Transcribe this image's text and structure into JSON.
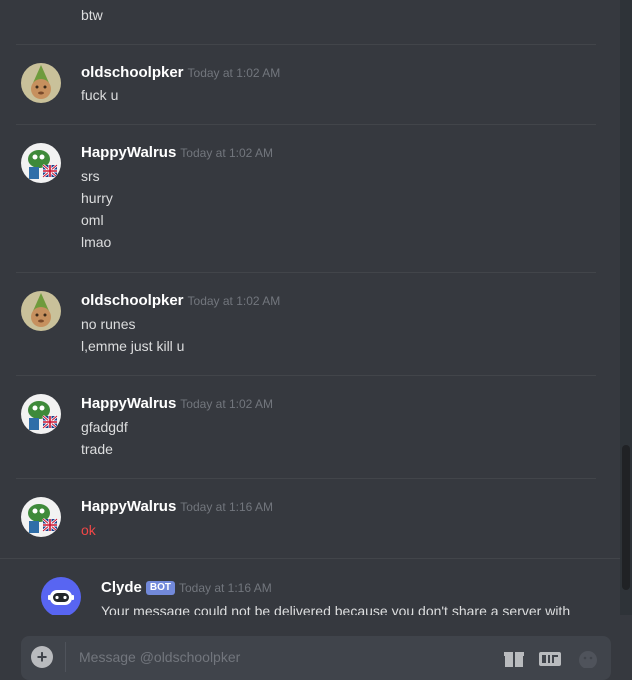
{
  "messages": [
    {
      "author": "oldschoolpker",
      "timestamp": "Today at 1:02 AM",
      "avatar": "gnome-child-avatar",
      "lines": [
        "fuck u"
      ]
    },
    {
      "author": "HappyWalrus",
      "timestamp": "Today at 1:02 AM",
      "avatar": "pepe-flag-avatar",
      "lines": [
        "srs",
        "hurry",
        "oml",
        "lmao"
      ]
    },
    {
      "author": "oldschoolpker",
      "timestamp": "Today at 1:02 AM",
      "avatar": "gnome-child-avatar",
      "lines": [
        "no runes",
        "l,emme just kill u"
      ]
    },
    {
      "author": "HappyWalrus",
      "timestamp": "Today at 1:02 AM",
      "avatar": "pepe-flag-avatar",
      "lines": [
        "gfadgdf",
        "trade"
      ]
    },
    {
      "author": "HappyWalrus",
      "timestamp": "Today at 1:16 AM",
      "avatar": "pepe-flag-avatar",
      "lines": [
        "ok"
      ],
      "failed": true
    }
  ],
  "continuation_line": "btw",
  "bot_message": {
    "author": "Clyde",
    "tag": "BOT",
    "timestamp": "Today at 1:16 AM",
    "text": "Your message could not be delivered because you don't share a server with"
  },
  "composer": {
    "placeholder": "Message @oldschoolpker",
    "attach_glyph": "+",
    "tools": [
      "gift-icon",
      "gif-icon",
      "emoji-icon"
    ]
  },
  "colors": {
    "background": "#36393f",
    "failed_text": "#f04747",
    "bot_tag": "#7289da",
    "clyde_avatar": "#5865f2"
  }
}
